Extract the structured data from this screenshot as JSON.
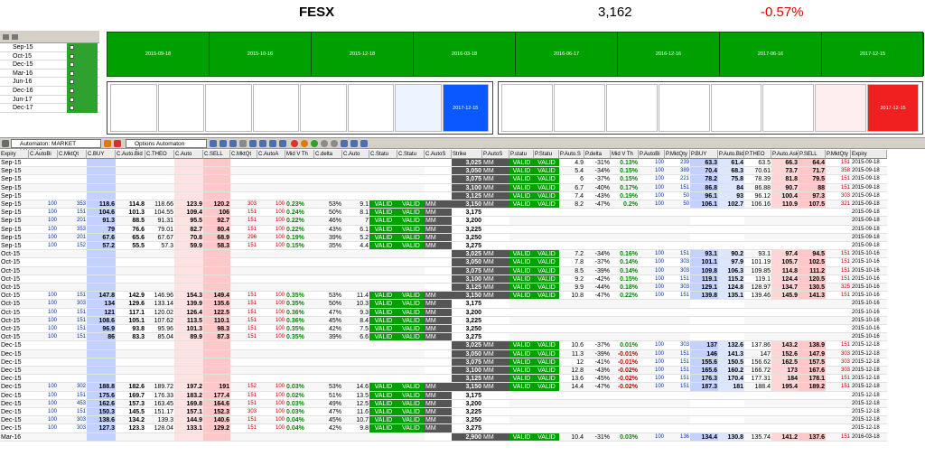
{
  "header": {
    "symbol": "FESX",
    "price": "3,162",
    "change": "-0.57%",
    "change_color": "#e00000"
  },
  "expiry_list": [
    "Sep-15",
    "Oct-15",
    "Dec-15",
    "Mar-16",
    "Jun-16",
    "Dec-16",
    "Jun-17",
    "Dec-17"
  ],
  "grid_top": {
    "dates": [
      "2015-09-18",
      "2015-10-16",
      "2015-12-18",
      "2016-03-18",
      "2016-06-17",
      "2016-12-16",
      "2017-06-16",
      "2017-12-15"
    ]
  },
  "call_boxes": {
    "active_label": "2017-12-15"
  },
  "put_boxes": {
    "active_label": "2017-12-15"
  },
  "toolbar": {
    "automaton_dropdown": "Automaton: MARKET MAKING",
    "summary_dropdown": "Options Automaton Summary"
  },
  "columns": [
    "Expiry",
    "C.AutoBi",
    "C.MktQt",
    "C.BUY",
    "C.Auto.Bid",
    "C.THEO",
    "C.Auto",
    "C.SELL",
    "C.MktQt",
    "C.AutoA",
    "Mid V Th",
    "C.delta",
    "C.Auto",
    "C.Statu",
    "C.Statu",
    "C.AutoS",
    "Strike",
    "P.AutoS",
    "P.statu",
    "P.Statu",
    "P.Auto.S",
    "P.delta",
    "Mid V Th",
    "P.AutoBi",
    "P.MktQty",
    "P.BUY",
    "P.Auto.Bid",
    "P.THEO",
    "P.Auto.Ask",
    "P.SELL",
    "P.MktQty",
    "Expiry"
  ],
  "rows": [
    [
      "Sep-15",
      "",
      "",
      "",
      "",
      "",
      "",
      "",
      "",
      "",
      "",
      "",
      "",
      "",
      "",
      "",
      "3,025",
      "MM",
      "VALID",
      "VALID",
      "4.9",
      "-31%",
      "0.13%",
      "100",
      "239",
      "63.3",
      "61.4",
      "63.5",
      "66.3",
      "64.4",
      "151",
      "2015-09-18"
    ],
    [
      "Sep-15",
      "",
      "",
      "",
      "",
      "",
      "",
      "",
      "",
      "",
      "",
      "",
      "",
      "",
      "",
      "",
      "3,050",
      "MM",
      "VALID",
      "VALID",
      "5.4",
      "-34%",
      "0.15%",
      "100",
      "389",
      "70.4",
      "68.3",
      "70.61",
      "73.7",
      "71.7",
      "358",
      "2015-09-18"
    ],
    [
      "Sep-15",
      "",
      "",
      "",
      "",
      "",
      "",
      "",
      "",
      "",
      "",
      "",
      "",
      "",
      "",
      "",
      "3,075",
      "MM",
      "VALID",
      "VALID",
      "6",
      "-37%",
      "0.15%",
      "100",
      "221",
      "78.2",
      "75.8",
      "78.39",
      "81.8",
      "79.5",
      "151",
      "2015-09-18"
    ],
    [
      "Sep-15",
      "",
      "",
      "",
      "",
      "",
      "",
      "",
      "",
      "",
      "",
      "",
      "",
      "",
      "",
      "",
      "3,100",
      "MM",
      "VALID",
      "VALID",
      "6.7",
      "-40%",
      "0.17%",
      "100",
      "151",
      "86.8",
      "84",
      "86.88",
      "90.7",
      "88",
      "151",
      "2015-09-18"
    ],
    [
      "Sep-15",
      "",
      "",
      "",
      "",
      "",
      "",
      "",
      "",
      "",
      "",
      "",
      "",
      "",
      "",
      "",
      "3,125",
      "MM",
      "VALID",
      "VALID",
      "7.4",
      "-43%",
      "0.19%",
      "100",
      "50",
      "96.1",
      "93",
      "96.12",
      "100.4",
      "97.3",
      "303",
      "2015-09-18"
    ],
    [
      "Sep-15",
      "100",
      "353",
      "118.6",
      "114.8",
      "118.66",
      "123.9",
      "120.2",
      "303",
      "100",
      "0.23%",
      "53%",
      "9.1",
      "VALID",
      "VALID",
      "MM",
      "3,150",
      "MM",
      "VALID",
      "VALID",
      "8.2",
      "-47%",
      "0.2%",
      "100",
      "50",
      "106.1",
      "102.7",
      "106.16",
      "110.9",
      "107.5",
      "321",
      "2015-09-18"
    ],
    [
      "Sep-15",
      "100",
      "151",
      "104.6",
      "101.3",
      "104.55",
      "109.4",
      "106",
      "151",
      "100",
      "0.24%",
      "50%",
      "8.1",
      "VALID",
      "VALID",
      "MM",
      "3,175",
      "",
      "",
      "",
      "",
      "",
      "",
      "",
      "",
      "",
      "",
      "",
      "",
      "",
      "",
      "2015-09-18"
    ],
    [
      "Sep-15",
      "100",
      "201",
      "91.3",
      "88.5",
      "91.31",
      "95.5",
      "92.7",
      "151",
      "100",
      "0.22%",
      "46%",
      "7",
      "VALID",
      "VALID",
      "MM",
      "3,200",
      "",
      "",
      "",
      "",
      "",
      "",
      "",
      "",
      "",
      "",
      "",
      "",
      "",
      "",
      "2015-09-18"
    ],
    [
      "Sep-15",
      "100",
      "353",
      "79",
      "76.6",
      "79.01",
      "82.7",
      "80.4",
      "151",
      "100",
      "0.22%",
      "43%",
      "6.1",
      "VALID",
      "VALID",
      "MM",
      "3,225",
      "",
      "",
      "",
      "",
      "",
      "",
      "",
      "",
      "",
      "",
      "",
      "",
      "",
      "",
      "2015-09-18"
    ],
    [
      "Sep-15",
      "100",
      "201",
      "67.6",
      "65.6",
      "67.67",
      "70.8",
      "68.9",
      "296",
      "100",
      "0.19%",
      "39%",
      "5.2",
      "VALID",
      "VALID",
      "MM",
      "3,250",
      "",
      "",
      "",
      "",
      "",
      "",
      "",
      "",
      "",
      "",
      "",
      "",
      "",
      "",
      "2015-09-18"
    ],
    [
      "Sep-15",
      "100",
      "152",
      "57.2",
      "55.5",
      "57.3",
      "59.9",
      "58.3",
      "151",
      "100",
      "0.15%",
      "35%",
      "4.4",
      "VALID",
      "VALID",
      "MM",
      "3,275",
      "",
      "",
      "",
      "",
      "",
      "",
      "",
      "",
      "",
      "",
      "",
      "",
      "",
      "",
      "2015-09-18"
    ],
    [
      "Oct-15",
      "",
      "",
      "",
      "",
      "",
      "",
      "",
      "",
      "",
      "",
      "",
      "",
      "",
      "",
      "",
      "3,025",
      "MM",
      "VALID",
      "VALID",
      "7.2",
      "-34%",
      "0.16%",
      "100",
      "151",
      "93.1",
      "90.2",
      "93.1",
      "97.4",
      "94.5",
      "151",
      "2015-10-16"
    ],
    [
      "Oct-15",
      "",
      "",
      "",
      "",
      "",
      "",
      "",
      "",
      "",
      "",
      "",
      "",
      "",
      "",
      "",
      "3,050",
      "MM",
      "VALID",
      "VALID",
      "7.8",
      "-37%",
      "0.14%",
      "100",
      "303",
      "101.1",
      "97.9",
      "101.19",
      "105.7",
      "102.5",
      "151",
      "2015-10-16"
    ],
    [
      "Oct-15",
      "",
      "",
      "",
      "",
      "",
      "",
      "",
      "",
      "",
      "",
      "",
      "",
      "",
      "",
      "",
      "3,075",
      "MM",
      "VALID",
      "VALID",
      "8.5",
      "-39%",
      "0.14%",
      "100",
      "303",
      "109.8",
      "106.3",
      "109.85",
      "114.8",
      "111.2",
      "151",
      "2015-10-16"
    ],
    [
      "Oct-15",
      "",
      "",
      "",
      "",
      "",
      "",
      "",
      "",
      "",
      "",
      "",
      "",
      "",
      "",
      "",
      "3,100",
      "MM",
      "VALID",
      "VALID",
      "9.2",
      "-42%",
      "0.15%",
      "100",
      "151",
      "119.1",
      "115.2",
      "119.1",
      "124.4",
      "120.5",
      "151",
      "2015-10-16"
    ],
    [
      "Oct-15",
      "",
      "",
      "",
      "",
      "",
      "",
      "",
      "",
      "",
      "",
      "",
      "",
      "",
      "",
      "",
      "3,125",
      "MM",
      "VALID",
      "VALID",
      "9.9",
      "-44%",
      "0.18%",
      "100",
      "303",
      "129.1",
      "124.8",
      "128.97",
      "134.7",
      "130.5",
      "325",
      "2015-10-16"
    ],
    [
      "Oct-15",
      "100",
      "151",
      "147.8",
      "142.9",
      "146.96",
      "154.3",
      "149.4",
      "151",
      "100",
      "0.35%",
      "53%",
      "11.4",
      "VALID",
      "VALID",
      "MM",
      "3,150",
      "MM",
      "VALID",
      "VALID",
      "10.8",
      "-47%",
      "0.22%",
      "100",
      "151",
      "139.8",
      "135.1",
      "139.46",
      "145.9",
      "141.3",
      "151",
      "2015-10-16"
    ],
    [
      "Oct-15",
      "100",
      "303",
      "134",
      "129.6",
      "133.14",
      "139.9",
      "135.6",
      "151",
      "100",
      "0.35%",
      "50%",
      "10.3",
      "VALID",
      "VALID",
      "MM",
      "3,175",
      "",
      "",
      "",
      "",
      "",
      "",
      "",
      "",
      "",
      "",
      "",
      "",
      "",
      "",
      "2015-10-16"
    ],
    [
      "Oct-15",
      "100",
      "151",
      "121",
      "117.1",
      "120.02",
      "126.4",
      "122.5",
      "151",
      "100",
      "0.36%",
      "47%",
      "9.3",
      "VALID",
      "VALID",
      "MM",
      "3,200",
      "",
      "",
      "",
      "",
      "",
      "",
      "",
      "",
      "",
      "",
      "",
      "",
      "",
      "",
      "2015-10-16"
    ],
    [
      "Oct-15",
      "100",
      "151",
      "108.6",
      "105.1",
      "107.62",
      "113.5",
      "110.1",
      "151",
      "100",
      "0.36%",
      "45%",
      "8.4",
      "VALID",
      "VALID",
      "MM",
      "3,225",
      "",
      "",
      "",
      "",
      "",
      "",
      "",
      "",
      "",
      "",
      "",
      "",
      "",
      "",
      "2015-10-16"
    ],
    [
      "Oct-15",
      "100",
      "151",
      "96.9",
      "93.8",
      "95.96",
      "101.3",
      "98.3",
      "151",
      "100",
      "0.35%",
      "42%",
      "7.5",
      "VALID",
      "VALID",
      "MM",
      "3,250",
      "",
      "",
      "",
      "",
      "",
      "",
      "",
      "",
      "",
      "",
      "",
      "",
      "",
      "",
      "2015-10-16"
    ],
    [
      "Oct-15",
      "100",
      "151",
      "86",
      "83.3",
      "85.04",
      "89.9",
      "87.3",
      "151",
      "100",
      "0.35%",
      "39%",
      "6.6",
      "VALID",
      "VALID",
      "MM",
      "3,275",
      "",
      "",
      "",
      "",
      "",
      "",
      "",
      "",
      "",
      "",
      "",
      "",
      "",
      "",
      "2015-10-16"
    ],
    [
      "Dec-15",
      "",
      "",
      "",
      "",
      "",
      "",
      "",
      "",
      "",
      "",
      "",
      "",
      "",
      "",
      "",
      "3,025",
      "MM",
      "VALID",
      "VALID",
      "10.6",
      "-37%",
      "0.01%",
      "100",
      "303",
      "137",
      "132.6",
      "137.86",
      "143.2",
      "138.9",
      "151",
      "2015-12-18"
    ],
    [
      "Dec-15",
      "",
      "",
      "",
      "",
      "",
      "",
      "",
      "",
      "",
      "",
      "",
      "",
      "",
      "",
      "",
      "3,050",
      "MM",
      "VALID",
      "VALID",
      "11.3",
      "-39%",
      "-0.01%",
      "100",
      "151",
      "146",
      "141.3",
      "147",
      "152.6",
      "147.9",
      "303",
      "2015-12-18"
    ],
    [
      "Dec-15",
      "",
      "",
      "",
      "",
      "",
      "",
      "",
      "",
      "",
      "",
      "",
      "",
      "",
      "",
      "",
      "3,075",
      "MM",
      "VALID",
      "VALID",
      "12",
      "-41%",
      "-0.01%",
      "100",
      "151",
      "155.6",
      "150.5",
      "156.62",
      "162.5",
      "157.5",
      "303",
      "2015-12-18"
    ],
    [
      "Dec-15",
      "",
      "",
      "",
      "",
      "",
      "",
      "",
      "",
      "",
      "",
      "",
      "",
      "",
      "",
      "",
      "3,100",
      "MM",
      "VALID",
      "VALID",
      "12.8",
      "-43%",
      "-0.02%",
      "100",
      "151",
      "165.6",
      "160.2",
      "166.72",
      "173",
      "167.6",
      "303",
      "2015-12-18"
    ],
    [
      "Dec-15",
      "",
      "",
      "",
      "",
      "",
      "",
      "",
      "",
      "",
      "",
      "",
      "",
      "",
      "",
      "",
      "3,125",
      "MM",
      "VALID",
      "VALID",
      "13.6",
      "-45%",
      "-0.02%",
      "100",
      "151",
      "176.3",
      "170.4",
      "177.31",
      "184",
      "178.1",
      "151",
      "2015-12-18"
    ],
    [
      "Dec-15",
      "100",
      "302",
      "188.8",
      "182.6",
      "189.72",
      "197.2",
      "191",
      "152",
      "100",
      "0.03%",
      "53%",
      "14.6",
      "VALID",
      "VALID",
      "MM",
      "3,150",
      "MM",
      "VALID",
      "VALID",
      "14.4",
      "-47%",
      "-0.02%",
      "100",
      "151",
      "187.3",
      "181",
      "188.4",
      "195.4",
      "189.2",
      "151",
      "2015-12-18"
    ],
    [
      "Dec-15",
      "100",
      "151",
      "175.6",
      "169.7",
      "176.33",
      "183.2",
      "177.4",
      "151",
      "100",
      "0.02%",
      "51%",
      "13.5",
      "VALID",
      "VALID",
      "MM",
      "3,175",
      "",
      "",
      "",
      "",
      "",
      "",
      "",
      "",
      "",
      "",
      "",
      "",
      "",
      "",
      "2015-12-18"
    ],
    [
      "Dec-15",
      "100",
      "453",
      "162.6",
      "157.3",
      "163.45",
      "169.8",
      "164.6",
      "151",
      "100",
      "0.03%",
      "49%",
      "12.5",
      "VALID",
      "VALID",
      "MM",
      "3,200",
      "",
      "",
      "",
      "",
      "",
      "",
      "",
      "",
      "",
      "",
      "",
      "",
      "",
      "",
      "2015-12-18"
    ],
    [
      "Dec-15",
      "100",
      "151",
      "150.3",
      "145.5",
      "151.17",
      "157.1",
      "152.3",
      "303",
      "100",
      "0.03%",
      "47%",
      "11.6",
      "VALID",
      "VALID",
      "MM",
      "3,225",
      "",
      "",
      "",
      "",
      "",
      "",
      "",
      "",
      "",
      "",
      "",
      "",
      "",
      "",
      "2015-12-18"
    ],
    [
      "Dec-15",
      "100",
      "303",
      "138.6",
      "134.2",
      "139.3",
      "144.9",
      "140.6",
      "151",
      "100",
      "0.04%",
      "45%",
      "10.7",
      "VALID",
      "VALID",
      "MM",
      "3,250",
      "",
      "",
      "",
      "",
      "",
      "",
      "",
      "",
      "",
      "",
      "",
      "",
      "",
      "",
      "2015-12-18"
    ],
    [
      "Dec-15",
      "100",
      "303",
      "127.3",
      "123.3",
      "128.04",
      "133.1",
      "129.2",
      "151",
      "100",
      "0.04%",
      "42%",
      "9.8",
      "VALID",
      "VALID",
      "MM",
      "3,275",
      "",
      "",
      "",
      "",
      "",
      "",
      "",
      "",
      "",
      "",
      "",
      "",
      "",
      "",
      "2015-12-18"
    ],
    [
      "Mar-16",
      "",
      "",
      "",
      "",
      "",
      "",
      "",
      "",
      "",
      "",
      "",
      "",
      "",
      "",
      "",
      "2,900",
      "MM",
      "VALID",
      "VALID",
      "10.4",
      "-31%",
      "0.03%",
      "100",
      "136",
      "134.4",
      "130.8",
      "135.74",
      "141.2",
      "137.6",
      "151",
      "2016-03-18"
    ]
  ],
  "colors": {
    "valid_green": "#00a000",
    "header_gray": "#ececec",
    "status_black": "#555555",
    "call_buy": "#c3d1ff",
    "call_sell": "#ffc8c8",
    "put_ask": "#ffd6d6",
    "active_box_blue": "#0a58ff",
    "active_box_red": "#f02020"
  }
}
